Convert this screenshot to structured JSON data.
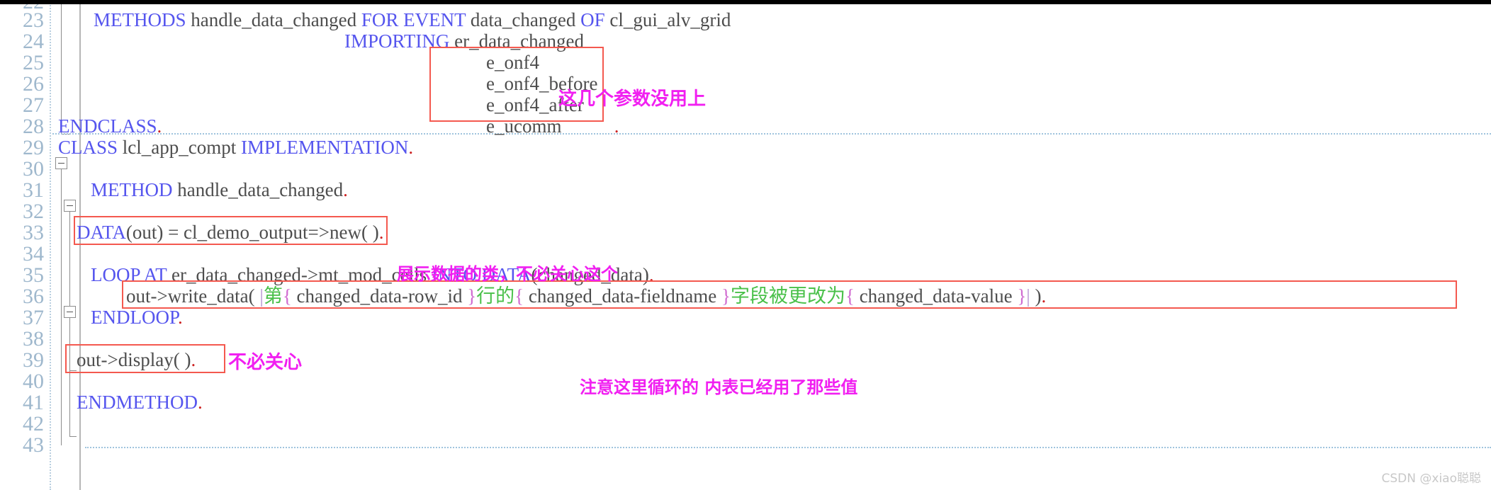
{
  "editor": {
    "language": "ABAP",
    "gutter_line_numbers": [
      "22",
      "23",
      "24",
      "25",
      "26",
      "27",
      "28",
      "29",
      "30",
      "31",
      "32",
      "33",
      "34",
      "35",
      "36",
      "37",
      "38",
      "39",
      "40",
      "41",
      "42",
      "43"
    ],
    "lines": [
      {
        "num": "22",
        "text": ""
      },
      {
        "num": "23",
        "text": "    METHODS handle_data_changed FOR EVENT data_changed OF cl_gui_alv_grid"
      },
      {
        "num": "24",
        "text": "                          IMPORTING er_data_changed"
      },
      {
        "num": "25",
        "text": "                                    e_onf4"
      },
      {
        "num": "26",
        "text": "                                    e_onf4_before"
      },
      {
        "num": "27",
        "text": "                                    e_onf4_after"
      },
      {
        "num": "28",
        "text": "                                    e_ucomm          ."
      },
      {
        "num": "29",
        "text": "ENDCLASS."
      },
      {
        "num": "30",
        "text": "CLASS lcl_app_compt IMPLEMENTATION."
      },
      {
        "num": "31",
        "text": ""
      },
      {
        "num": "32",
        "text": "  METHOD handle_data_changed."
      },
      {
        "num": "33",
        "text": ""
      },
      {
        "num": "34",
        "text": "  DATA(out) = cl_demo_output=>new( )."
      },
      {
        "num": "35",
        "text": ""
      },
      {
        "num": "36",
        "text": "    LOOP AT er_data_changed->mt_mod_cells INTO DATA(changed_data)."
      },
      {
        "num": "37",
        "text": "      out->write_data( |第{ changed_data-row_id }行的{ changed_data-fieldname }字段被更改为{ changed_data-value }| )."
      },
      {
        "num": "38",
        "text": "    ENDLOOP."
      },
      {
        "num": "39",
        "text": ""
      },
      {
        "num": "40",
        "text": "  out->display( )."
      },
      {
        "num": "41",
        "text": ""
      },
      {
        "num": "42",
        "text": "  ENDMETHOD."
      },
      {
        "num": "43",
        "text": ""
      }
    ],
    "tokens": {
      "l23": {
        "kw1": "METHODS",
        "id1": " handle_data_changed ",
        "kw2": "FOR EVENT",
        "id2": " data_changed ",
        "kw3": "OF",
        "id3": " cl_gui_alv_grid"
      },
      "l24": {
        "kw": "IMPORTING",
        "id": " er_data_changed"
      },
      "l25": {
        "id": "e_onf4"
      },
      "l26": {
        "id": "e_onf4_before"
      },
      "l27": {
        "id": "e_onf4_after"
      },
      "l28": {
        "id": "e_ucomm",
        "dot": "."
      },
      "l29": {
        "kw": "ENDCLASS",
        "dot": "."
      },
      "l30": {
        "kw1": "CLASS",
        "id1": " lcl_app_compt ",
        "kw2": "IMPLEMENTATION",
        "dot": "."
      },
      "l32": {
        "kw": "METHOD",
        "id": " handle_data_changed",
        "dot": "."
      },
      "l34": {
        "kw": "DATA",
        "id1": "(out) = cl_demo_output=>new( )",
        "dot": "."
      },
      "l36": {
        "kw1": "LOOP AT",
        "id1": " er_data_changed->mt_mod_cells ",
        "kw2": "INTO",
        "sp": " ",
        "kw3": "DATA",
        "id2": "(changed_data)",
        "dot": "."
      },
      "l37": {
        "id1": "out->write_data( ",
        "pipe1": "|",
        "str1": "第",
        "brace1": "{",
        "id2": " changed_data-row_id ",
        "brace2": "}",
        "str2": "行的",
        "brace3": "{",
        "id3": " changed_data-fieldname ",
        "brace4": "}",
        "str3": "字段被更改为",
        "brace5": "{",
        "id4": " changed_data-value ",
        "brace6": "}",
        "pipe2": "|",
        "id5": " )",
        "dot": "."
      },
      "l38": {
        "kw": "ENDLOOP",
        "dot": "."
      },
      "l40": {
        "id": "out->display( )",
        "dot": "."
      },
      "l42": {
        "kw": "ENDMETHOD",
        "dot": "."
      }
    }
  },
  "annotations": [
    {
      "id": "anno-unused-params",
      "text": "这几个参数没用上"
    },
    {
      "id": "anno-display-class",
      "text": "展示数据的类，不必关心这个"
    },
    {
      "id": "anno-loop-note",
      "text": "注意这里循环的 内表已经用了那些值"
    },
    {
      "id": "anno-no-care",
      "text": "不必关心"
    }
  ],
  "highlight_boxes": [
    {
      "id": "box-importing-params",
      "label": "importing-parameters"
    },
    {
      "id": "box-data-out",
      "label": "data-out-declaration"
    },
    {
      "id": "box-write-data",
      "label": "write-data-string-template"
    },
    {
      "id": "box-display",
      "label": "display-call"
    }
  ],
  "colors": {
    "keyword": "#5555ee",
    "identifier": "#4d4d4d",
    "string": "#49c049",
    "brace": "#d06ad0",
    "period": "#cc2222",
    "line_number": "#9fb8cd",
    "annotation": "#f11ff1",
    "box_border": "#f4594f",
    "background": "#ffffff"
  },
  "watermark": {
    "text": "CSDN @xiao聪聪"
  }
}
